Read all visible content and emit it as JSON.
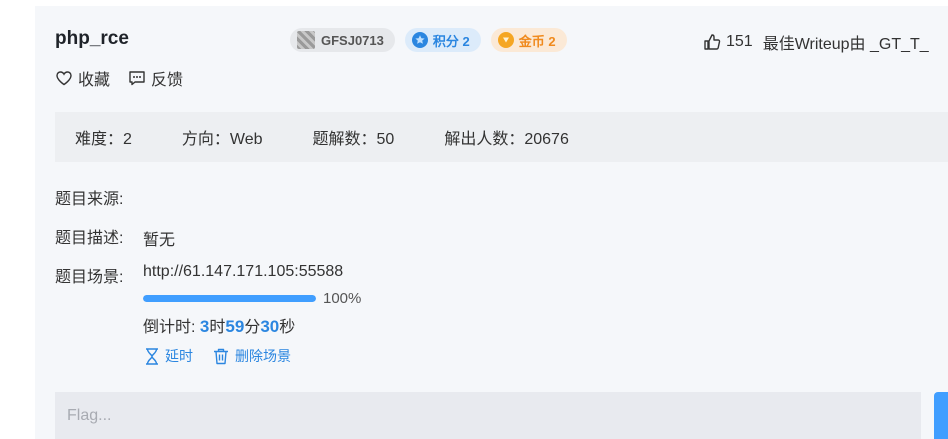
{
  "challenge": {
    "title": "php_rce",
    "author": "GFSJ0713",
    "score_label": "积分 2",
    "coin_label": "金币 2",
    "likes": "151",
    "best_writeup": "最佳Writeup由 _GT_T_"
  },
  "actions": {
    "favorite": "收藏",
    "feedback": "反馈"
  },
  "info": {
    "difficulty": "难度：2",
    "direction": "方向：Web",
    "writeups": "题解数：50",
    "solvers": "解出人数：20676"
  },
  "details": {
    "source_label": "题目来源:",
    "source_value": "",
    "desc_label": "题目描述:",
    "desc_value": "暂无",
    "scene_label": "题目场景:",
    "scene_url": "http://61.147.171.105:55588",
    "progress": 100,
    "progress_text": "100%",
    "countdown_prefix": "倒计时: ",
    "hours": "3",
    "hours_unit": "时",
    "minutes": "59",
    "minutes_unit": "分",
    "seconds": "30",
    "seconds_unit": "秒",
    "extend_label": "延时",
    "delete_label": "删除场景"
  },
  "flag": {
    "placeholder": "Flag..."
  },
  "colors": {
    "accent": "#409eff",
    "link": "#2b86e0",
    "coin": "#f08a1d"
  },
  "icons": [
    "heart-icon",
    "feedback-icon",
    "thumbs-up-icon",
    "star-badge-icon",
    "coin-icon",
    "hourglass-icon",
    "trash-icon"
  ]
}
